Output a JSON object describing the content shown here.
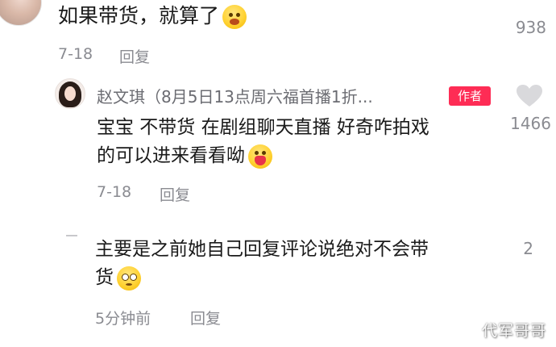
{
  "comments": [
    {
      "text": "如果带货，就算了",
      "emoji": "laughing-crying-emoji",
      "date": "7-18",
      "reply_label": "回复",
      "likes": "938"
    },
    {
      "author": "赵文琪（8月5日13点周六福首播1折...",
      "badge": "作者",
      "text_line1": "宝宝 不带货 在剧组聊天直播 好奇咋拍戏",
      "text_line2": "的可以进来看看呦",
      "emoji": "heart-hug-emoji",
      "date": "7-18",
      "reply_label": "回复",
      "likes": "1466",
      "like_icon": "heart-icon"
    },
    {
      "text_line1": "主要是之前她自己回复评论说绝对不会带",
      "text_line2": "货",
      "emoji": "pleading-emoji",
      "date": "5分钟前",
      "reply_label": "回复",
      "likes": "2"
    }
  ],
  "watermark": "代军哥哥",
  "colors": {
    "badge": "#fe2c55",
    "meta": "#8a8b91",
    "text": "#1a1a1a"
  }
}
